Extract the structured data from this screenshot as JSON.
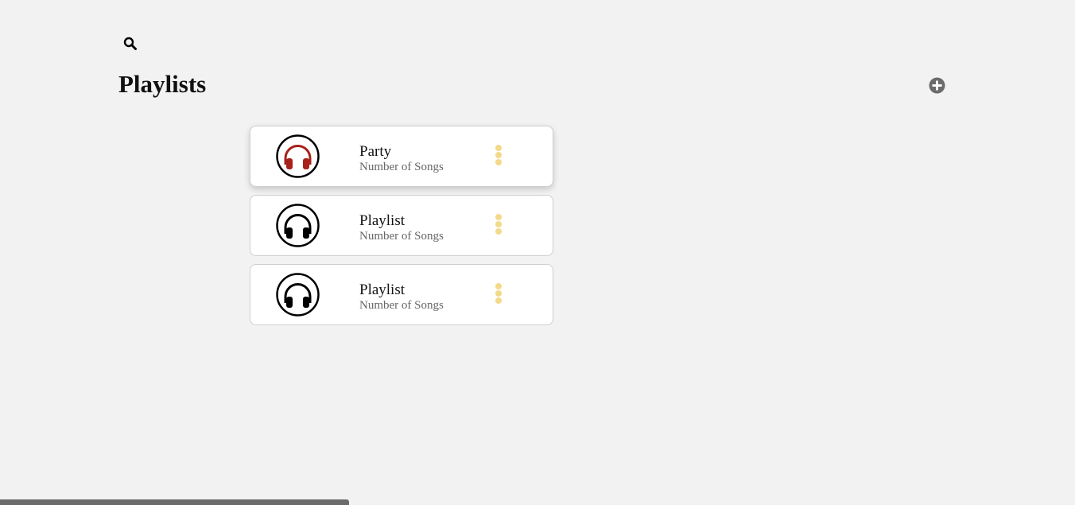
{
  "header": {
    "title": "Playlists",
    "search_icon": "search-icon",
    "add_icon": "plus-circle-icon"
  },
  "playlists": [
    {
      "name": "Party",
      "subtitle": "Number of Songs",
      "icon": "headphones-icon",
      "icon_color": "#a8201a",
      "active": true
    },
    {
      "name": "Playlist",
      "subtitle": "Number of Songs",
      "icon": "headphones-icon",
      "icon_color": "#000000",
      "active": false
    },
    {
      "name": "Playlist",
      "subtitle": "Number of Songs",
      "icon": "headphones-icon",
      "icon_color": "#000000",
      "active": false
    }
  ],
  "colors": {
    "background": "#f2f2f2",
    "menu_dots": "#f5d98a",
    "add_button": "#6b6b6b"
  }
}
